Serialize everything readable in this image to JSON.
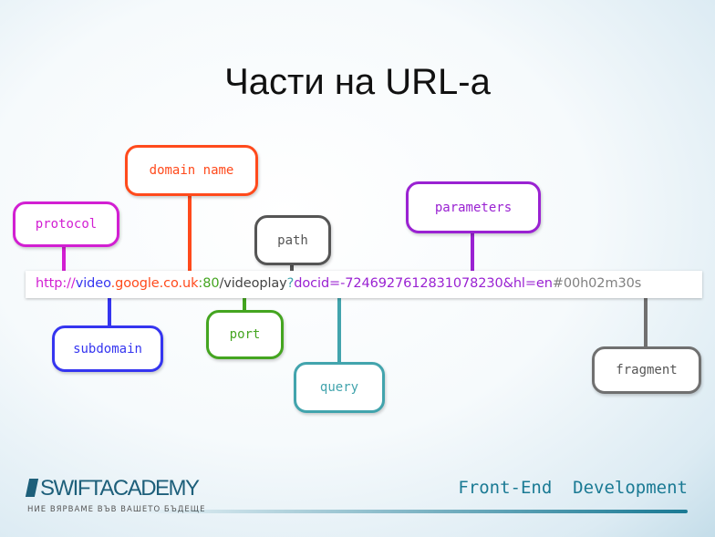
{
  "title": "Части на URL-a",
  "url": {
    "protocol": "http://",
    "subdomain": "video",
    "domain": ".google.co.uk",
    "port": ":80",
    "path": "/videoplay",
    "query_mark": "?",
    "parameters": "docid=-7246927612831078230&hl=en",
    "fragment": "#00h02m30s"
  },
  "labels": {
    "protocol": "protocol",
    "domain": "domain name",
    "path": "path",
    "parameters": "parameters",
    "subdomain": "subdomain",
    "port": "port",
    "query": "query",
    "fragment": "fragment"
  },
  "colors": {
    "protocol": "#d21fd2",
    "subdomain": "#3535f0",
    "domain": "#ff4a1c",
    "port": "#44a520",
    "path": "#555555",
    "query": "#42a4ad",
    "parameters": "#9a22d2",
    "fragment": "#707070"
  },
  "footer": {
    "logo": "SWIFTACADEMY",
    "tagline": "НИЕ ВЯРВАМЕ ВЪВ ВАШЕТО БЪДЕЩЕ",
    "course": "Front-End  Development"
  }
}
